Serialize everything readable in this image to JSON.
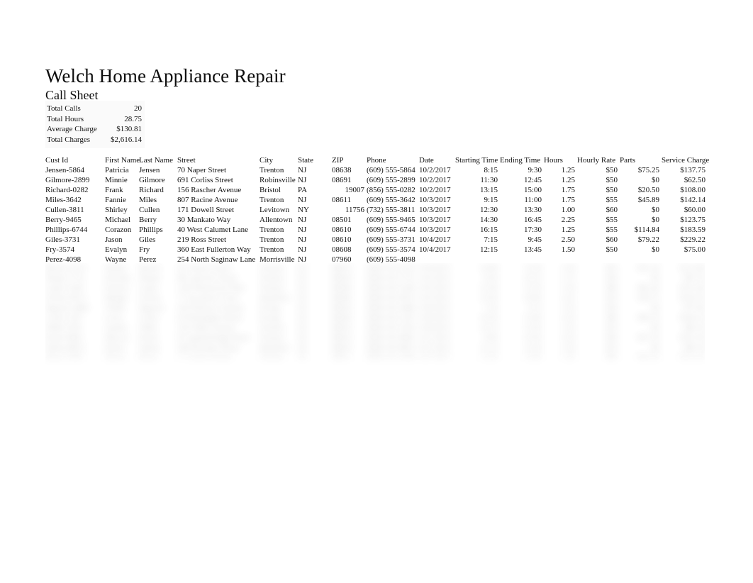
{
  "document": {
    "title": "Welch Home Appliance Repair",
    "subtitle": "Call Sheet"
  },
  "summary": {
    "rows": [
      {
        "label": "Total Calls",
        "value": "20"
      },
      {
        "label": "Total Hours",
        "value": "28.75"
      },
      {
        "label": "Average Charge",
        "value": "$130.81"
      },
      {
        "label": "Total Charges",
        "value": "$2,616.14"
      }
    ]
  },
  "table": {
    "headers": [
      "Cust Id",
      "First Name",
      "Last Name",
      "Street",
      "City",
      "State",
      "ZIP",
      "Phone",
      "Date",
      "Starting Time",
      "Ending Time",
      "Hours",
      "Hourly Rate",
      "Parts",
      "Service Charge"
    ],
    "rows": [
      {
        "cust_id": "Jensen-5864",
        "first_name": "Patricia",
        "last_name": "Jensen",
        "street": "70 Naper Street",
        "city": "Trenton",
        "state": "NJ",
        "zip": "08638",
        "zip_align": "left",
        "phone": "(609) 555-5864",
        "date": "10/2/2017",
        "starting_time": "8:15",
        "ending_time": "9:30",
        "hours": "1.25",
        "hourly_rate": "$50",
        "parts": "$75.25",
        "service_charge": "$137.75"
      },
      {
        "cust_id": "Gilmore-2899",
        "first_name": "Minnie",
        "last_name": "Gilmore",
        "street": "691 Corliss Street",
        "city": "Robinsville",
        "state": "NJ",
        "zip": "08691",
        "zip_align": "left",
        "phone": "(609) 555-2899",
        "date": "10/2/2017",
        "starting_time": "11:30",
        "ending_time": "12:45",
        "hours": "1.25",
        "hourly_rate": "$50",
        "parts": "$0",
        "service_charge": "$62.50"
      },
      {
        "cust_id": "Richard-0282",
        "first_name": "Frank",
        "last_name": "Richard",
        "street": "156 Rascher Avenue",
        "city": "Bristol",
        "state": "PA",
        "zip": "19007",
        "zip_align": "right",
        "phone": "(856) 555-0282",
        "date": "10/2/2017",
        "starting_time": "13:15",
        "ending_time": "15:00",
        "hours": "1.75",
        "hourly_rate": "$50",
        "parts": "$20.50",
        "service_charge": "$108.00"
      },
      {
        "cust_id": "Miles-3642",
        "first_name": "Fannie",
        "last_name": "Miles",
        "street": "807 Racine Avenue",
        "city": "Trenton",
        "state": "NJ",
        "zip": "08611",
        "zip_align": "left",
        "phone": "(609) 555-3642",
        "date": "10/3/2017",
        "starting_time": "9:15",
        "ending_time": "11:00",
        "hours": "1.75",
        "hourly_rate": "$55",
        "parts": "$45.89",
        "service_charge": "$142.14"
      },
      {
        "cust_id": "Cullen-3811",
        "first_name": "Shirley",
        "last_name": "Cullen",
        "street": "171 Dowell Street",
        "city": "Levitown",
        "state": "NY",
        "zip": "11756",
        "zip_align": "right",
        "phone": "(732) 555-3811",
        "date": "10/3/2017",
        "starting_time": "12:30",
        "ending_time": "13:30",
        "hours": "1.00",
        "hourly_rate": "$60",
        "parts": "$0",
        "service_charge": "$60.00"
      },
      {
        "cust_id": "Berry-9465",
        "first_name": "Michael",
        "last_name": "Berry",
        "street": "30 Mankato Way",
        "city": "Allentown",
        "state": "NJ",
        "zip": "08501",
        "zip_align": "left",
        "phone": "(609) 555-9465",
        "date": "10/3/2017",
        "starting_time": "14:30",
        "ending_time": "16:45",
        "hours": "2.25",
        "hourly_rate": "$55",
        "parts": "$0",
        "service_charge": "$123.75"
      },
      {
        "cust_id": "Phillips-6744",
        "first_name": "Corazon",
        "last_name": "Phillips",
        "street": "40 West Calumet Lane",
        "city": "Trenton",
        "state": "NJ",
        "zip": "08610",
        "zip_align": "left",
        "phone": "(609) 555-6744",
        "date": "10/3/2017",
        "starting_time": "16:15",
        "ending_time": "17:30",
        "hours": "1.25",
        "hourly_rate": "$55",
        "parts": "$114.84",
        "service_charge": "$183.59"
      },
      {
        "cust_id": "Giles-3731",
        "first_name": "Jason",
        "last_name": "Giles",
        "street": "219 Ross Street",
        "city": "Trenton",
        "state": "NJ",
        "zip": "08610",
        "zip_align": "left",
        "phone": "(609) 555-3731",
        "date": "10/4/2017",
        "starting_time": "7:15",
        "ending_time": "9:45",
        "hours": "2.50",
        "hourly_rate": "$60",
        "parts": "$79.22",
        "service_charge": "$229.22"
      },
      {
        "cust_id": "Fry-3574",
        "first_name": "Evalyn",
        "last_name": "Fry",
        "street": "360 East Fullerton Way",
        "city": "Trenton",
        "state": "NJ",
        "zip": "08608",
        "zip_align": "left",
        "phone": "(609) 555-3574",
        "date": "10/4/2017",
        "starting_time": "12:15",
        "ending_time": "13:45",
        "hours": "1.50",
        "hourly_rate": "$50",
        "parts": "$0",
        "service_charge": "$75.00"
      },
      {
        "cust_id": "Perez-4098",
        "first_name": "Wayne",
        "last_name": "Perez",
        "street": "254 North Saginaw Lane",
        "city": "Morrisville",
        "state": "NJ",
        "zip": "07960",
        "zip_align": "left",
        "phone": "(609) 555-4098",
        "date": "",
        "starting_time": "",
        "ending_time": "",
        "hours": "",
        "hourly_rate": "",
        "parts": "",
        "service_charge": ""
      }
    ]
  },
  "obscured_region": {
    "note": "Remaining call-sheet rows are blurred out and illegible in the screenshot.",
    "visible_row_count": 10
  }
}
